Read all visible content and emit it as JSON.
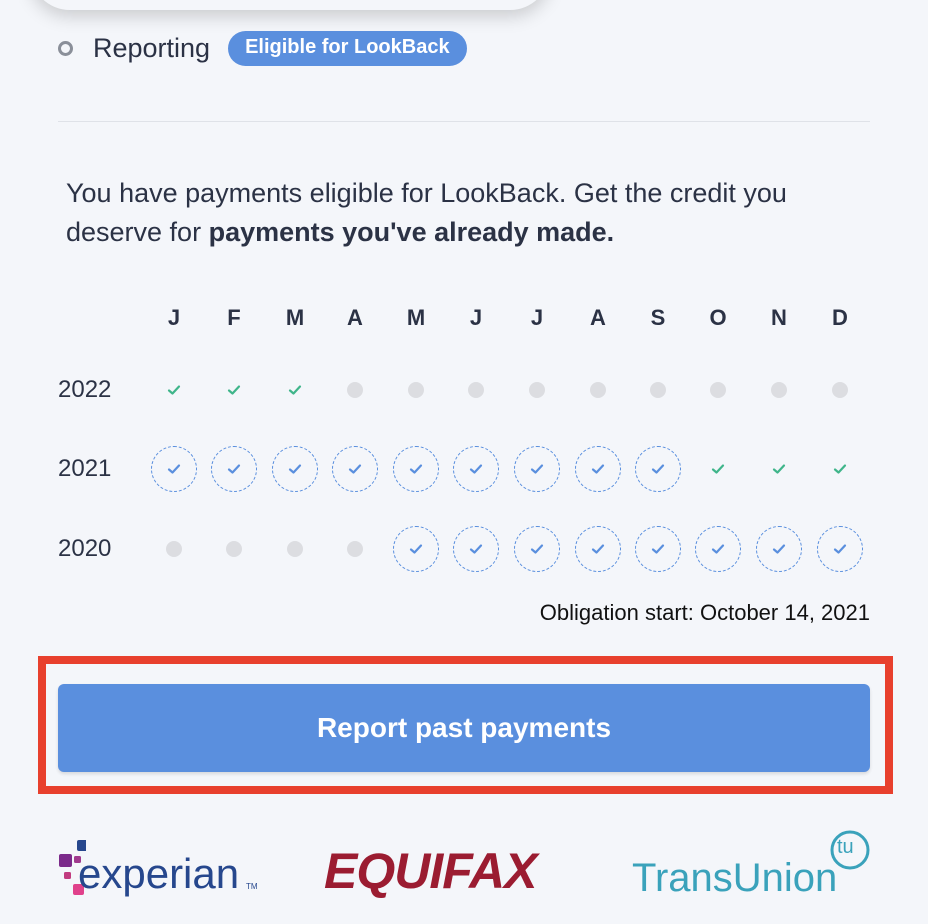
{
  "header": {
    "title": "Reporting",
    "badge": "Eligible for LookBack"
  },
  "intro": {
    "text": "You have payments eligible for LookBack. Get the credit you deserve for ",
    "bold": "payments you've already made."
  },
  "calendar": {
    "months": [
      "J",
      "F",
      "M",
      "A",
      "M",
      "J",
      "J",
      "A",
      "S",
      "O",
      "N",
      "D"
    ],
    "rows": [
      {
        "year": "2022",
        "cells": [
          "check",
          "check",
          "check",
          "empty",
          "empty",
          "empty",
          "empty",
          "empty",
          "empty",
          "empty",
          "empty",
          "empty"
        ]
      },
      {
        "year": "2021",
        "cells": [
          "lookback",
          "lookback",
          "lookback",
          "lookback",
          "lookback",
          "lookback",
          "lookback",
          "lookback",
          "lookback",
          "check",
          "check",
          "check"
        ]
      },
      {
        "year": "2020",
        "cells": [
          "empty",
          "empty",
          "empty",
          "empty",
          "lookback",
          "lookback",
          "lookback",
          "lookback",
          "lookback",
          "lookback",
          "lookback",
          "lookback"
        ]
      }
    ]
  },
  "obligation": "Obligation start: October 14, 2021",
  "button": {
    "label": "Report past payments"
  },
  "bureaus": {
    "experian": "experian",
    "equifax": "EQUIFAX",
    "transunion": "TransUnion",
    "transunion_mark": "tu",
    "tm": "TM"
  },
  "colors": {
    "accent": "#5a8fde",
    "check_green": "#3fb58a",
    "highlight": "#e8402d"
  }
}
